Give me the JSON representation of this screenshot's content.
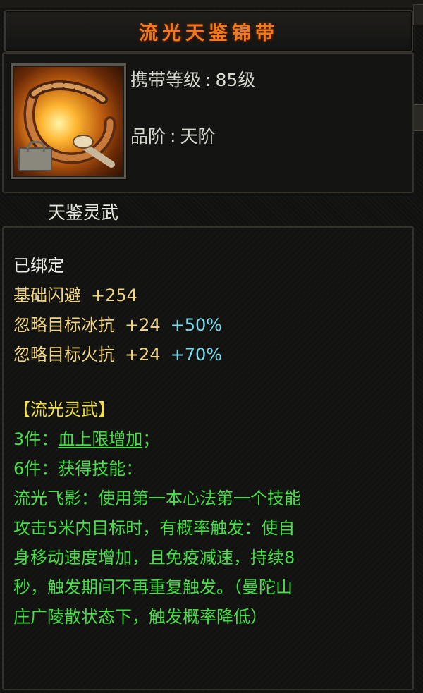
{
  "item": {
    "name": "流光天鉴锦带",
    "carry_level_label": "携带等级",
    "carry_level_value": "85级",
    "grade_label": "品阶",
    "grade_value": "天阶",
    "set_name": "天鉴灵武",
    "bound_status": "已绑定"
  },
  "stats": [
    {
      "name": "基础闪避",
      "value": "+254",
      "extra": ""
    },
    {
      "name": "忽略目标冰抗",
      "value": "+24",
      "extra": "+50%"
    },
    {
      "name": "忽略目标火抗",
      "value": "+24",
      "extra": "+70%"
    }
  ],
  "set_bonus": {
    "title": "【流光灵武】",
    "piece3_prefix": "3件：",
    "piece3_effect": "血上限增加",
    "piece3_suffix": "；",
    "piece6": "6件：获得技能：",
    "skill_lines": [
      "流光飞影：使用第一本心法第一个技能",
      "攻击5米内目标时，有概率触发：使自",
      "身移动速度增加，且免疫减速，持续8",
      "秒，触发期间不再重复触发。（曼陀山",
      "庄广陵散状态下，触发概率降低）"
    ]
  },
  "colors": {
    "title": "#f07a1a",
    "stat_name": "#f0d47e",
    "stat_percent": "#76dcec",
    "set_text": "#45e045",
    "set_title": "#f2e23a"
  },
  "icons": {
    "item_icon": "belt-icon",
    "bound_badge": "lock-icon"
  }
}
